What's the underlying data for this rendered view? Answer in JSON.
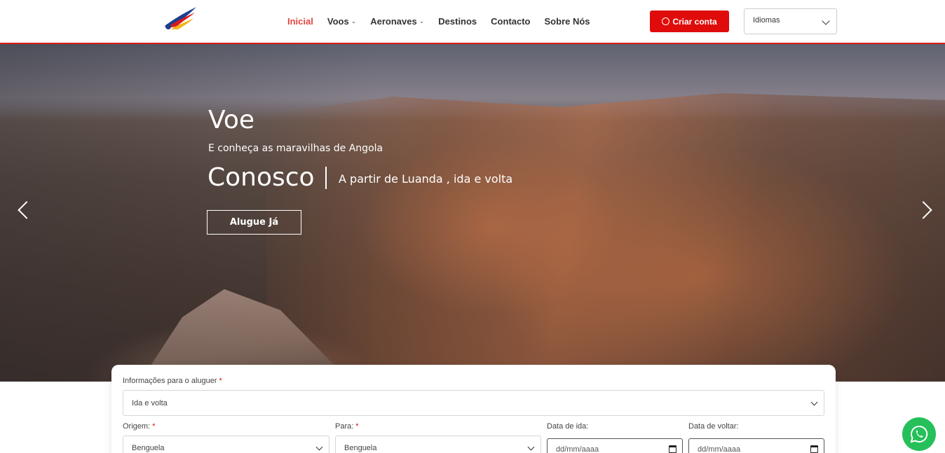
{
  "header": {
    "nav": [
      {
        "label": "Inicial",
        "active": true,
        "dropdown": false
      },
      {
        "label": "Voos",
        "active": false,
        "dropdown": true
      },
      {
        "label": "Aeronaves",
        "active": false,
        "dropdown": true
      },
      {
        "label": "Destinos",
        "active": false,
        "dropdown": false
      },
      {
        "label": "Contacto",
        "active": false,
        "dropdown": false
      },
      {
        "label": "Sobre Nós",
        "active": false,
        "dropdown": false
      }
    ],
    "create_account_label": "Criar conta",
    "language_select": "Idiomas"
  },
  "hero": {
    "title": "Voe",
    "subtitle": "E conheça as maravilhas de Angola",
    "title2": "Conosco",
    "route": "A partir de Luanda , ida e volta",
    "cta_label": "Alugue Já"
  },
  "form": {
    "trip_label": "Informações para o aluguer",
    "trip_value": "Ida e volta",
    "origin_label": "Origem:",
    "origin_value": "Benguela",
    "destination_label": "Para:",
    "destination_value": "Benguela",
    "depart_label": "Data de ida:",
    "depart_placeholder": "dd/mm/aaaa",
    "return_label": "Data de voltar:",
    "return_placeholder": "dd/mm/aaaa",
    "required_mark": "*"
  },
  "colors": {
    "accent": "#e00b0b",
    "nav_active": "#e4463f",
    "whatsapp": "#25c05a"
  }
}
